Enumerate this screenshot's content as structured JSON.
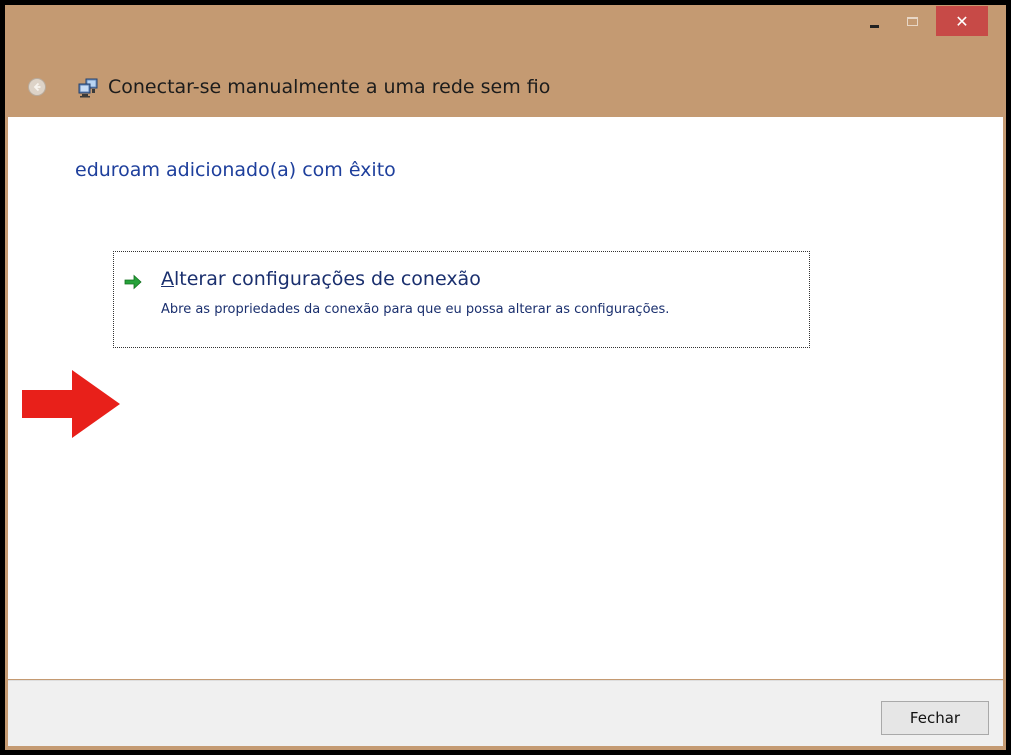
{
  "window": {
    "title": "Conectar-se manualmente a uma rede sem fio",
    "controls": {
      "minimize_icon": "minimize-icon",
      "maximize_icon": "maximize-icon",
      "close_glyph": "✕"
    }
  },
  "content": {
    "success_message": "eduroam adicionado(a) com êxito",
    "option": {
      "title_accel": "A",
      "title_rest": "lterar configurações de conexão",
      "description": "Abre as propriedades da conexão para que eu possa alterar as configurações.",
      "icon": "green-arrow-icon"
    },
    "annotation": {
      "icon": "red-arrow-annotation",
      "color": "#e8201a"
    }
  },
  "footer": {
    "close_label": "Fechar"
  },
  "colors": {
    "frame": "#c49a72",
    "close_button": "#c74a47",
    "heading_blue": "#1e3f9c",
    "link_blue": "#1a2f6e"
  }
}
